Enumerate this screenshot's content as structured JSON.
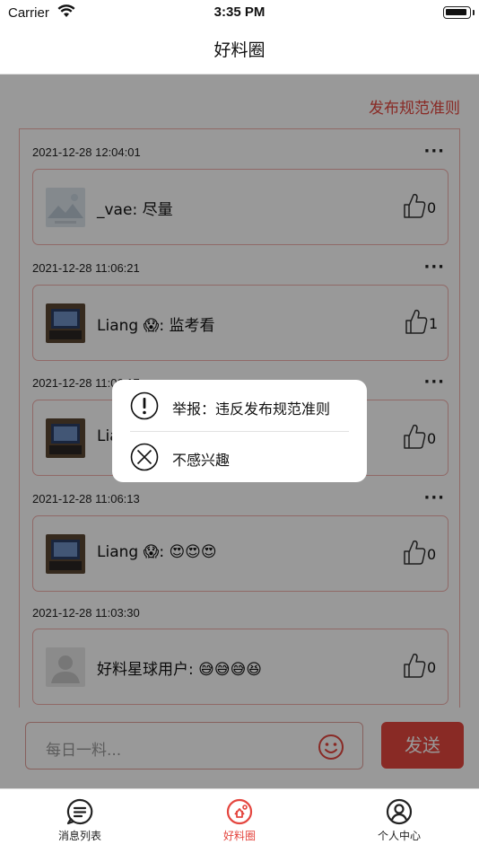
{
  "status_bar": {
    "carrier": "Carrier",
    "time": "3:35 PM"
  },
  "nav": {
    "title": "好料圈"
  },
  "rules_link": "发布规范准则",
  "posts": [
    {
      "time": "2021-12-28 12:04:01",
      "user": "_vae",
      "text": "尽量",
      "likes": "0",
      "avatar": "placeholder-image"
    },
    {
      "time": "2021-12-28 11:06:21",
      "user": "Liang 😱",
      "text": "监考看",
      "likes": "1",
      "avatar": "laptop-photo"
    },
    {
      "time": "2021-12-28 11:06:17",
      "user": "Liang 😱",
      "text": "",
      "likes": "0",
      "avatar": "laptop-photo"
    },
    {
      "time": "2021-12-28 11:06:13",
      "user": "Liang 😱",
      "text": "😍😍😍",
      "likes": "0",
      "avatar": "laptop-photo"
    },
    {
      "time": "2021-12-28 11:03:30",
      "user": "好料星球用户",
      "text": "😅😅😅😆",
      "likes": "0",
      "avatar": "default-user"
    }
  ],
  "more_label": "···",
  "popup": {
    "report_label": "举报：违反发布规范准则",
    "not_interested_label": "不感兴趣"
  },
  "composer": {
    "placeholder": "每日一料...",
    "send_label": "发送"
  },
  "tabs": [
    {
      "label": "消息列表",
      "icon": "message-list-icon"
    },
    {
      "label": "好料圈",
      "icon": "circle-feed-icon",
      "active": true
    },
    {
      "label": "个人中心",
      "icon": "profile-icon"
    }
  ],
  "colors": {
    "accent": "#e4463f",
    "card_border": "#f0b0ac",
    "overlay": "rgba(0,0,0,0.40)"
  }
}
